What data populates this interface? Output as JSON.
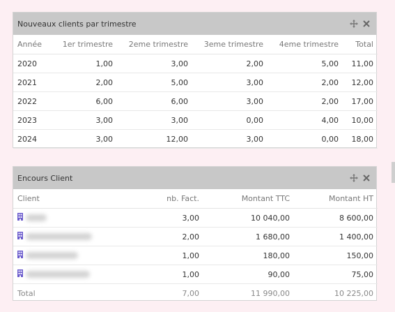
{
  "widget1": {
    "title": "Nouveaux clients par trimestre",
    "columns": [
      "Année",
      "1er trimestre",
      "2eme trimestre",
      "3eme trimestre",
      "4eme trimestre",
      "Total"
    ],
    "rows": [
      [
        "2020",
        "1,00",
        "3,00",
        "2,00",
        "5,00",
        "11,00"
      ],
      [
        "2021",
        "2,00",
        "5,00",
        "3,00",
        "2,00",
        "12,00"
      ],
      [
        "2022",
        "6,00",
        "6,00",
        "3,00",
        "2,00",
        "17,00"
      ],
      [
        "2023",
        "3,00",
        "3,00",
        "0,00",
        "4,00",
        "10,00"
      ],
      [
        "2024",
        "3,00",
        "12,00",
        "3,00",
        "0,00",
        "18,00"
      ]
    ]
  },
  "widget2": {
    "title": "Encours Client",
    "columns": [
      "Client",
      "nb. Fact.",
      "Montant TTC",
      "Montant HT"
    ],
    "rows": [
      [
        "3,00",
        "10 040,00",
        "8 600,00"
      ],
      [
        "2,00",
        "1 680,00",
        "1 400,00"
      ],
      [
        "1,00",
        "180,00",
        "150,00"
      ],
      [
        "1,00",
        "90,00",
        "75,00"
      ]
    ],
    "total": [
      "Total",
      "7,00",
      "11 990,00",
      "10 225,00"
    ]
  },
  "icons": {
    "move": "move-icon",
    "close": "close-icon",
    "client": "building-icon"
  },
  "colors": {
    "background": "#fdeff3",
    "header": "#c8c8c8",
    "icon_purple": "#6a5acd"
  }
}
